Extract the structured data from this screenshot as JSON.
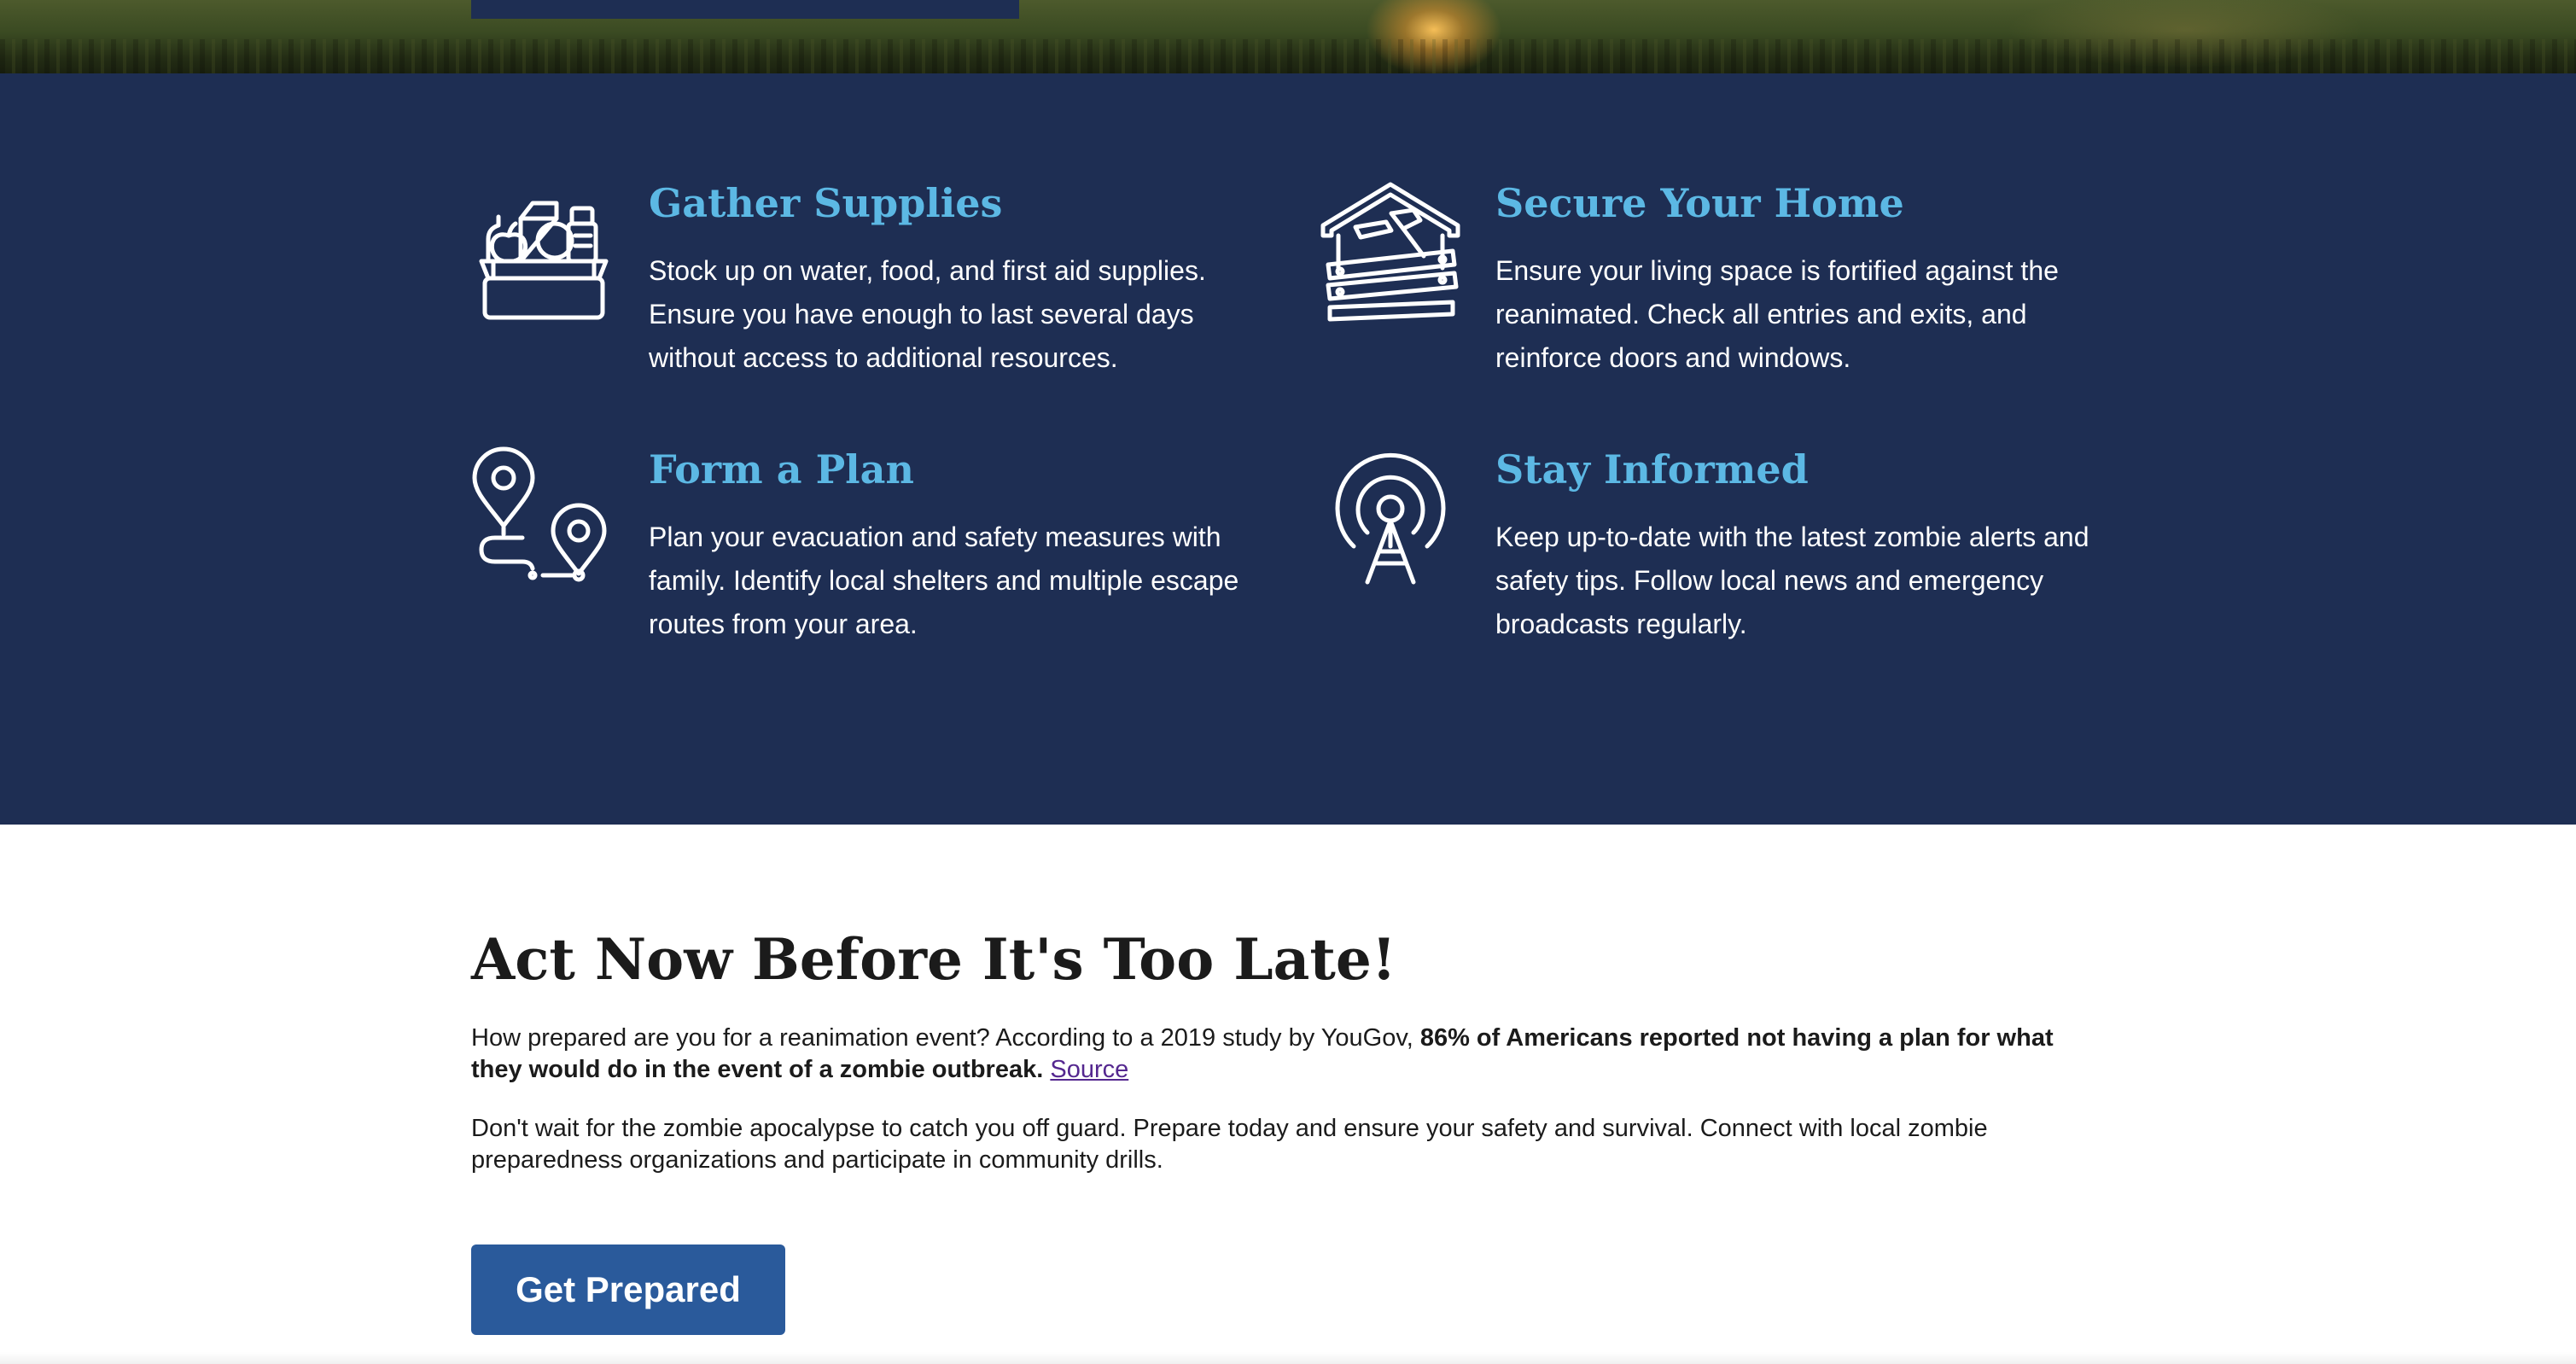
{
  "colors": {
    "tips_background": "#1e2e53",
    "tip_title": "#5cb8e4",
    "tip_text": "#ffffff",
    "heading_text": "#1b1b1b",
    "link": "#54278f",
    "cta_background": "#2a5a9b",
    "cta_text": "#ffffff"
  },
  "tips": [
    {
      "icon": "supply-box-icon",
      "title": "Gather Supplies",
      "description": "Stock up on water, food, and first aid supplies. Ensure you have enough to last several days without access to additional resources."
    },
    {
      "icon": "boarded-house-icon",
      "title": "Secure Your Home",
      "description": "Ensure your living space is fortified against the reanimated. Check all entries and exits, and reinforce doors and windows."
    },
    {
      "icon": "route-pins-icon",
      "title": "Form a Plan",
      "description": "Plan your evacuation and safety measures with family. Identify local shelters and multiple escape routes from your area."
    },
    {
      "icon": "radio-tower-icon",
      "title": "Stay Informed",
      "description": "Keep up-to-date with the latest zombie alerts and safety tips. Follow local news and emergency broadcasts regularly."
    }
  ],
  "act_now": {
    "heading": "Act Now Before It's Too Late!",
    "paragraph1_lead": "How prepared are you for a reanimation event? According to a 2019 study by YouGov, ",
    "paragraph1_bold": "86% of Americans reported not having a plan for what they would do in the event of a zombie outbreak.",
    "source_link": "Source",
    "paragraph2": "Don't wait for the zombie apocalypse to catch you off guard. Prepare today and ensure your safety and survival. Connect with local zombie preparedness organizations and participate in community drills.",
    "cta_label": "Get Prepared"
  }
}
